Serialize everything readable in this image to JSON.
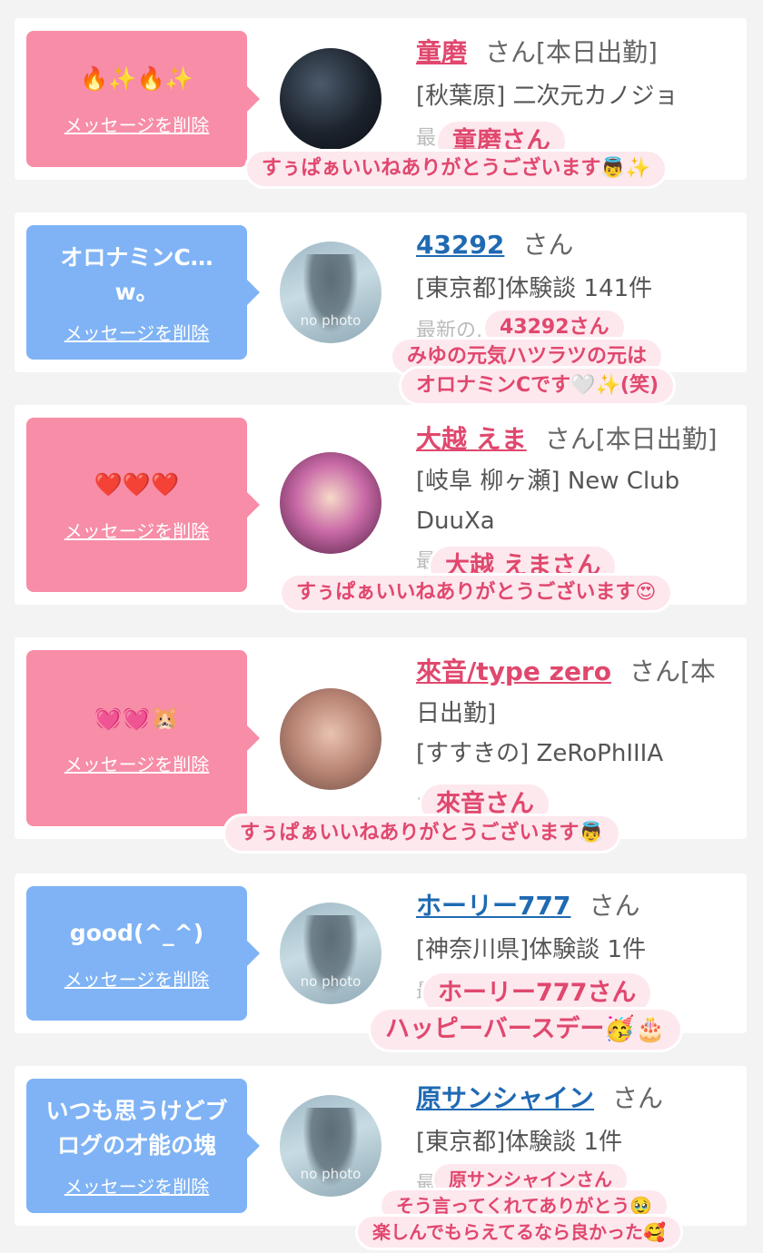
{
  "cards": [
    {
      "message": "🔥✨🔥✨",
      "delete_label": "メッセージを削除",
      "name": "童磨",
      "san": "さん[本日出勤]",
      "detail1": "[秋葉原] 二次元カノジョ",
      "faded": "最… を見る",
      "sticker_name": "童磨さん",
      "sticker_text": "すぅぱぁいいねありがとうございます👼✨"
    },
    {
      "message": "オロナミンC… w。",
      "delete_label": "メッセージを削除",
      "name": "43292",
      "san": "さん",
      "detail1": "[東京都]体験談 141件",
      "faded": "最新の…",
      "sticker_name": "43292さん",
      "sticker_line1": "みゆの元気ハツラツの元は",
      "sticker_line2": "オロナミンCです🤍✨(笑)"
    },
    {
      "message": "❤️❤️❤️",
      "delete_label": "メッセージを削除",
      "name": "大越 えま",
      "san": "さん[本日出勤]",
      "detail1": "[岐阜 柳ヶ瀬] New Club",
      "detail2": "DuuXa",
      "faded": "最… る",
      "sticker_name": "大越 えまさん",
      "sticker_text": "すぅぱぁいいねありがとうございます😍"
    },
    {
      "message": "💓💓🐹",
      "delete_label": "メッセージを削除",
      "name": "來音/type zero",
      "san": "さん[本",
      "detail0": "日出勤]",
      "detail1": "[すすきの] ZeRoPhIIIA",
      "faded": "… を見る",
      "sticker_name": "來音さん",
      "sticker_text": "すぅぱぁいいねありがとうございます👼"
    },
    {
      "message": "good(^_^)",
      "delete_label": "メッセージを削除",
      "name": "ホーリー777",
      "san": "さん",
      "detail1": "[神奈川県]体験談 1件",
      "faded": "最…",
      "sticker_name": "ホーリー777さん",
      "sticker_text": "ハッピーバースデー🥳🎂"
    },
    {
      "message": "いつも思うけどブログの才能の塊",
      "delete_label": "メッセージを削除",
      "name": "原サンシャイン",
      "san": "さん",
      "detail1": "[東京都]体験談 1件",
      "faded": "最…",
      "sticker_name": "原サンシャインさん",
      "sticker_line1": "そう言ってくれてありがとう🥹",
      "sticker_line2": "楽しんでもらえてるなら良かった🥰"
    }
  ],
  "nophoto_label": "no photo",
  "colors": {
    "pink": "#f78da7",
    "blue": "#7fb3f5",
    "name_pink": "#e0486e",
    "name_blue": "#1f6ab3"
  }
}
